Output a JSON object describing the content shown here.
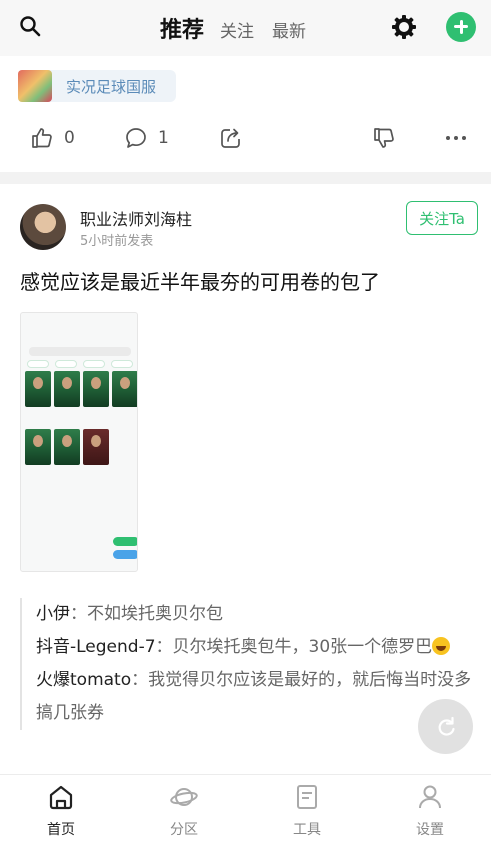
{
  "header": {
    "tabs": [
      {
        "label": "推荐",
        "active": true
      },
      {
        "label": "关注",
        "active": false
      },
      {
        "label": "最新",
        "active": false
      }
    ],
    "icons": [
      "search-icon",
      "gear-icon",
      "add-icon"
    ],
    "accent_color": "#2fbf71"
  },
  "top_card": {
    "tag_label": "实况足球国服",
    "like_count": "0",
    "comment_count": "1"
  },
  "post": {
    "author": "职业法师刘海柱",
    "time": "5小时前发表",
    "follow_label": "关注Ta",
    "title": "感觉应该是最近半年最夯的可用卷的包了",
    "comments": [
      {
        "user": "小伊",
        "text": "不如埃托奥贝尔包"
      },
      {
        "user": "抖音-Legend-7",
        "text": "贝尔埃托奥包牛，30张一个德罗巴"
      },
      {
        "user": "火爆tomato",
        "text": "我觉得贝尔应该是最好的，就后悔当时没多搞几张券"
      }
    ]
  },
  "bottom_nav": [
    {
      "label": "首页",
      "icon": "home-icon",
      "active": true
    },
    {
      "label": "分区",
      "icon": "planet-icon",
      "active": false
    },
    {
      "label": "工具",
      "icon": "document-icon",
      "active": false
    },
    {
      "label": "设置",
      "icon": "user-icon",
      "active": false
    }
  ]
}
